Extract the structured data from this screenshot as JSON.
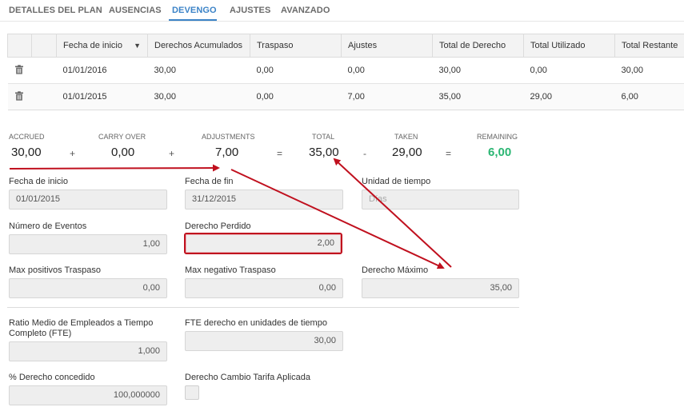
{
  "tabs": [
    "DETALLES DEL PLAN",
    "AUSENCIAS",
    "DEVENGO",
    "AJUSTES",
    "AVANZADO"
  ],
  "active_tab": "DEVENGO",
  "grid": {
    "headers": [
      "Fecha de inicio",
      "Derechos Acumulados",
      "Traspaso",
      "Ajustes",
      "Total de Derecho",
      "Total Utilizado",
      "Total Restante"
    ],
    "rows": [
      [
        "01/01/2016",
        "30,00",
        "0,00",
        "0,00",
        "30,00",
        "0,00",
        "30,00"
      ],
      [
        "01/01/2015",
        "30,00",
        "0,00",
        "7,00",
        "35,00",
        "29,00",
        "6,00"
      ]
    ]
  },
  "summary": {
    "accrued_label": "ACCRUED",
    "accrued": "30,00",
    "carry_label": "CARRY OVER",
    "carry": "0,00",
    "adjust_label": "ADJUSTMENTS",
    "adjust": "7,00",
    "total_label": "TOTAL",
    "total": "35,00",
    "taken_label": "TAKEN",
    "taken": "29,00",
    "remaining_label": "REMAINING",
    "remaining": "6,00",
    "op_plus": "+",
    "op_eq": "=",
    "op_minus": "-",
    "remaining_color": "#2bb673"
  },
  "form": {
    "fecha_inicio_label": "Fecha de inicio",
    "fecha_inicio": "01/01/2015",
    "fecha_fin_label": "Fecha de fin",
    "fecha_fin": "31/12/2015",
    "unidad_label": "Unidad de tiempo",
    "unidad_placeholder": "Días",
    "num_eventos_label": "Número de Eventos",
    "num_eventos": "1,00",
    "derecho_perdido_label": "Derecho Perdido",
    "derecho_perdido": "2,00",
    "max_pos_label": "Max positivos Traspaso",
    "max_pos": "0,00",
    "max_neg_label": "Max negativo Traspaso",
    "max_neg": "0,00",
    "derecho_max_label": "Derecho Máximo",
    "derecho_max": "35,00",
    "ratio_label_1": "Ratio Medio de Empleados a Tiempo",
    "ratio_label_2": "Completo (FTE)",
    "ratio": "1,000",
    "fte_label": "FTE derecho en unidades de tiempo",
    "fte": "30,00",
    "pct_label": "% Derecho concedido",
    "pct": "100,000000",
    "cambio_label": "Derecho Cambio Tarifa Aplicada"
  },
  "annotation_color": "#c0101e"
}
